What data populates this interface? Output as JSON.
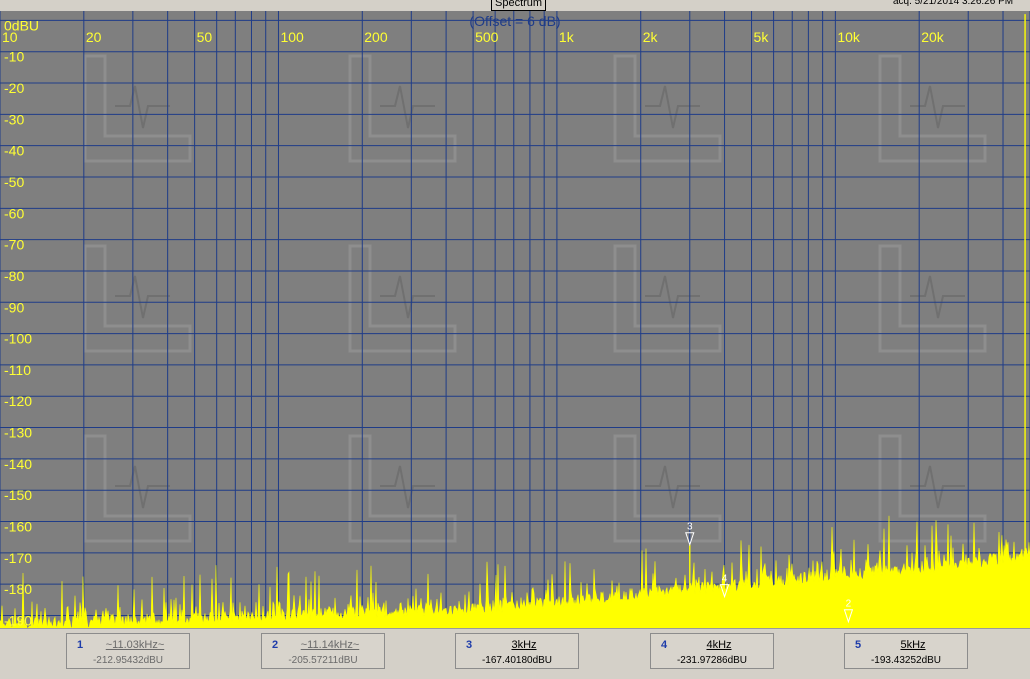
{
  "window": {
    "tab_label": "Spectrum",
    "acq_text": "acq. 5/21/2014 3:26:26 PM"
  },
  "plot": {
    "offset_label": "(Offset = 6 dB)"
  },
  "chart_data": {
    "type": "line",
    "title": "",
    "xlabel": "",
    "ylabel": "",
    "x_scale": "log",
    "xlim": [
      10,
      50000
    ],
    "ylim": [
      -194,
      3
    ],
    "grid": true,
    "x_tick_labels": [
      {
        "value": 10,
        "label": "10"
      },
      {
        "value": 20,
        "label": "20"
      },
      {
        "value": 50,
        "label": "50"
      },
      {
        "value": 100,
        "label": "100"
      },
      {
        "value": 200,
        "label": "200"
      },
      {
        "value": 500,
        "label": "500"
      },
      {
        "value": 1000,
        "label": "1k"
      },
      {
        "value": 2000,
        "label": "2k"
      },
      {
        "value": 5000,
        "label": "5k"
      },
      {
        "value": 10000,
        "label": "10k"
      },
      {
        "value": 20000,
        "label": "20k"
      },
      {
        "value": 50000,
        "label": "50"
      }
    ],
    "y_tick_labels": [
      {
        "value": 0,
        "label": "0dBU"
      },
      {
        "value": -10,
        "label": "-10"
      },
      {
        "value": -20,
        "label": "-20"
      },
      {
        "value": -30,
        "label": "-30"
      },
      {
        "value": -40,
        "label": "-40"
      },
      {
        "value": -50,
        "label": "-50"
      },
      {
        "value": -60,
        "label": "-60"
      },
      {
        "value": -70,
        "label": "-70"
      },
      {
        "value": -80,
        "label": "-80"
      },
      {
        "value": -90,
        "label": "-90"
      },
      {
        "value": -100,
        "label": "-100"
      },
      {
        "value": -110,
        "label": "-110"
      },
      {
        "value": -120,
        "label": "-120"
      },
      {
        "value": -130,
        "label": "-130"
      },
      {
        "value": -140,
        "label": "-140"
      },
      {
        "value": -150,
        "label": "-150"
      },
      {
        "value": -160,
        "label": "-160"
      },
      {
        "value": -170,
        "label": "-170"
      },
      {
        "value": -180,
        "label": "-180"
      },
      {
        "value": -190,
        "label": "-190"
      }
    ],
    "series": [
      {
        "color": "#ffff00",
        "x": [
          10,
          20,
          50,
          100,
          200,
          500,
          1000,
          2000,
          5000,
          10000,
          20000,
          40000,
          50000
        ],
        "y": [
          -191,
          -190,
          -189,
          -188,
          -187,
          -186,
          -184,
          -181,
          -178,
          -175,
          -173,
          -170,
          -168
        ]
      }
    ],
    "peaks": [
      {
        "x": 48000,
        "y": 2
      },
      {
        "x": 3000,
        "y": -167.4
      }
    ],
    "markers": [
      {
        "num": "3",
        "x": 3000,
        "y": -167.4
      },
      {
        "num": "4",
        "x": 4000,
        "y": -184
      },
      {
        "num": "2",
        "x": 11140,
        "y": -192
      }
    ]
  },
  "marker_readouts": [
    {
      "num": "1",
      "freq": "~11.03kHz~",
      "level": "-212.95432dBU",
      "state": "dim"
    },
    {
      "num": "2",
      "freq": "~11.14kHz~",
      "level": "-205.57211dBU",
      "state": "dim"
    },
    {
      "num": "3",
      "freq": "3kHz",
      "level": "-167.40180dBU",
      "state": "active"
    },
    {
      "num": "4",
      "freq": "4kHz",
      "level": "-231.97286dBU",
      "state": "active"
    },
    {
      "num": "5",
      "freq": "5kHz",
      "level": "-193.43252dBU",
      "state": "active"
    }
  ],
  "colors": {
    "plot_bg": "#7f7f7f",
    "grid": "#1f3c88",
    "axis_labels": "#ffff33",
    "trace": "#ffff00",
    "offset_text": "#1f3c88"
  }
}
